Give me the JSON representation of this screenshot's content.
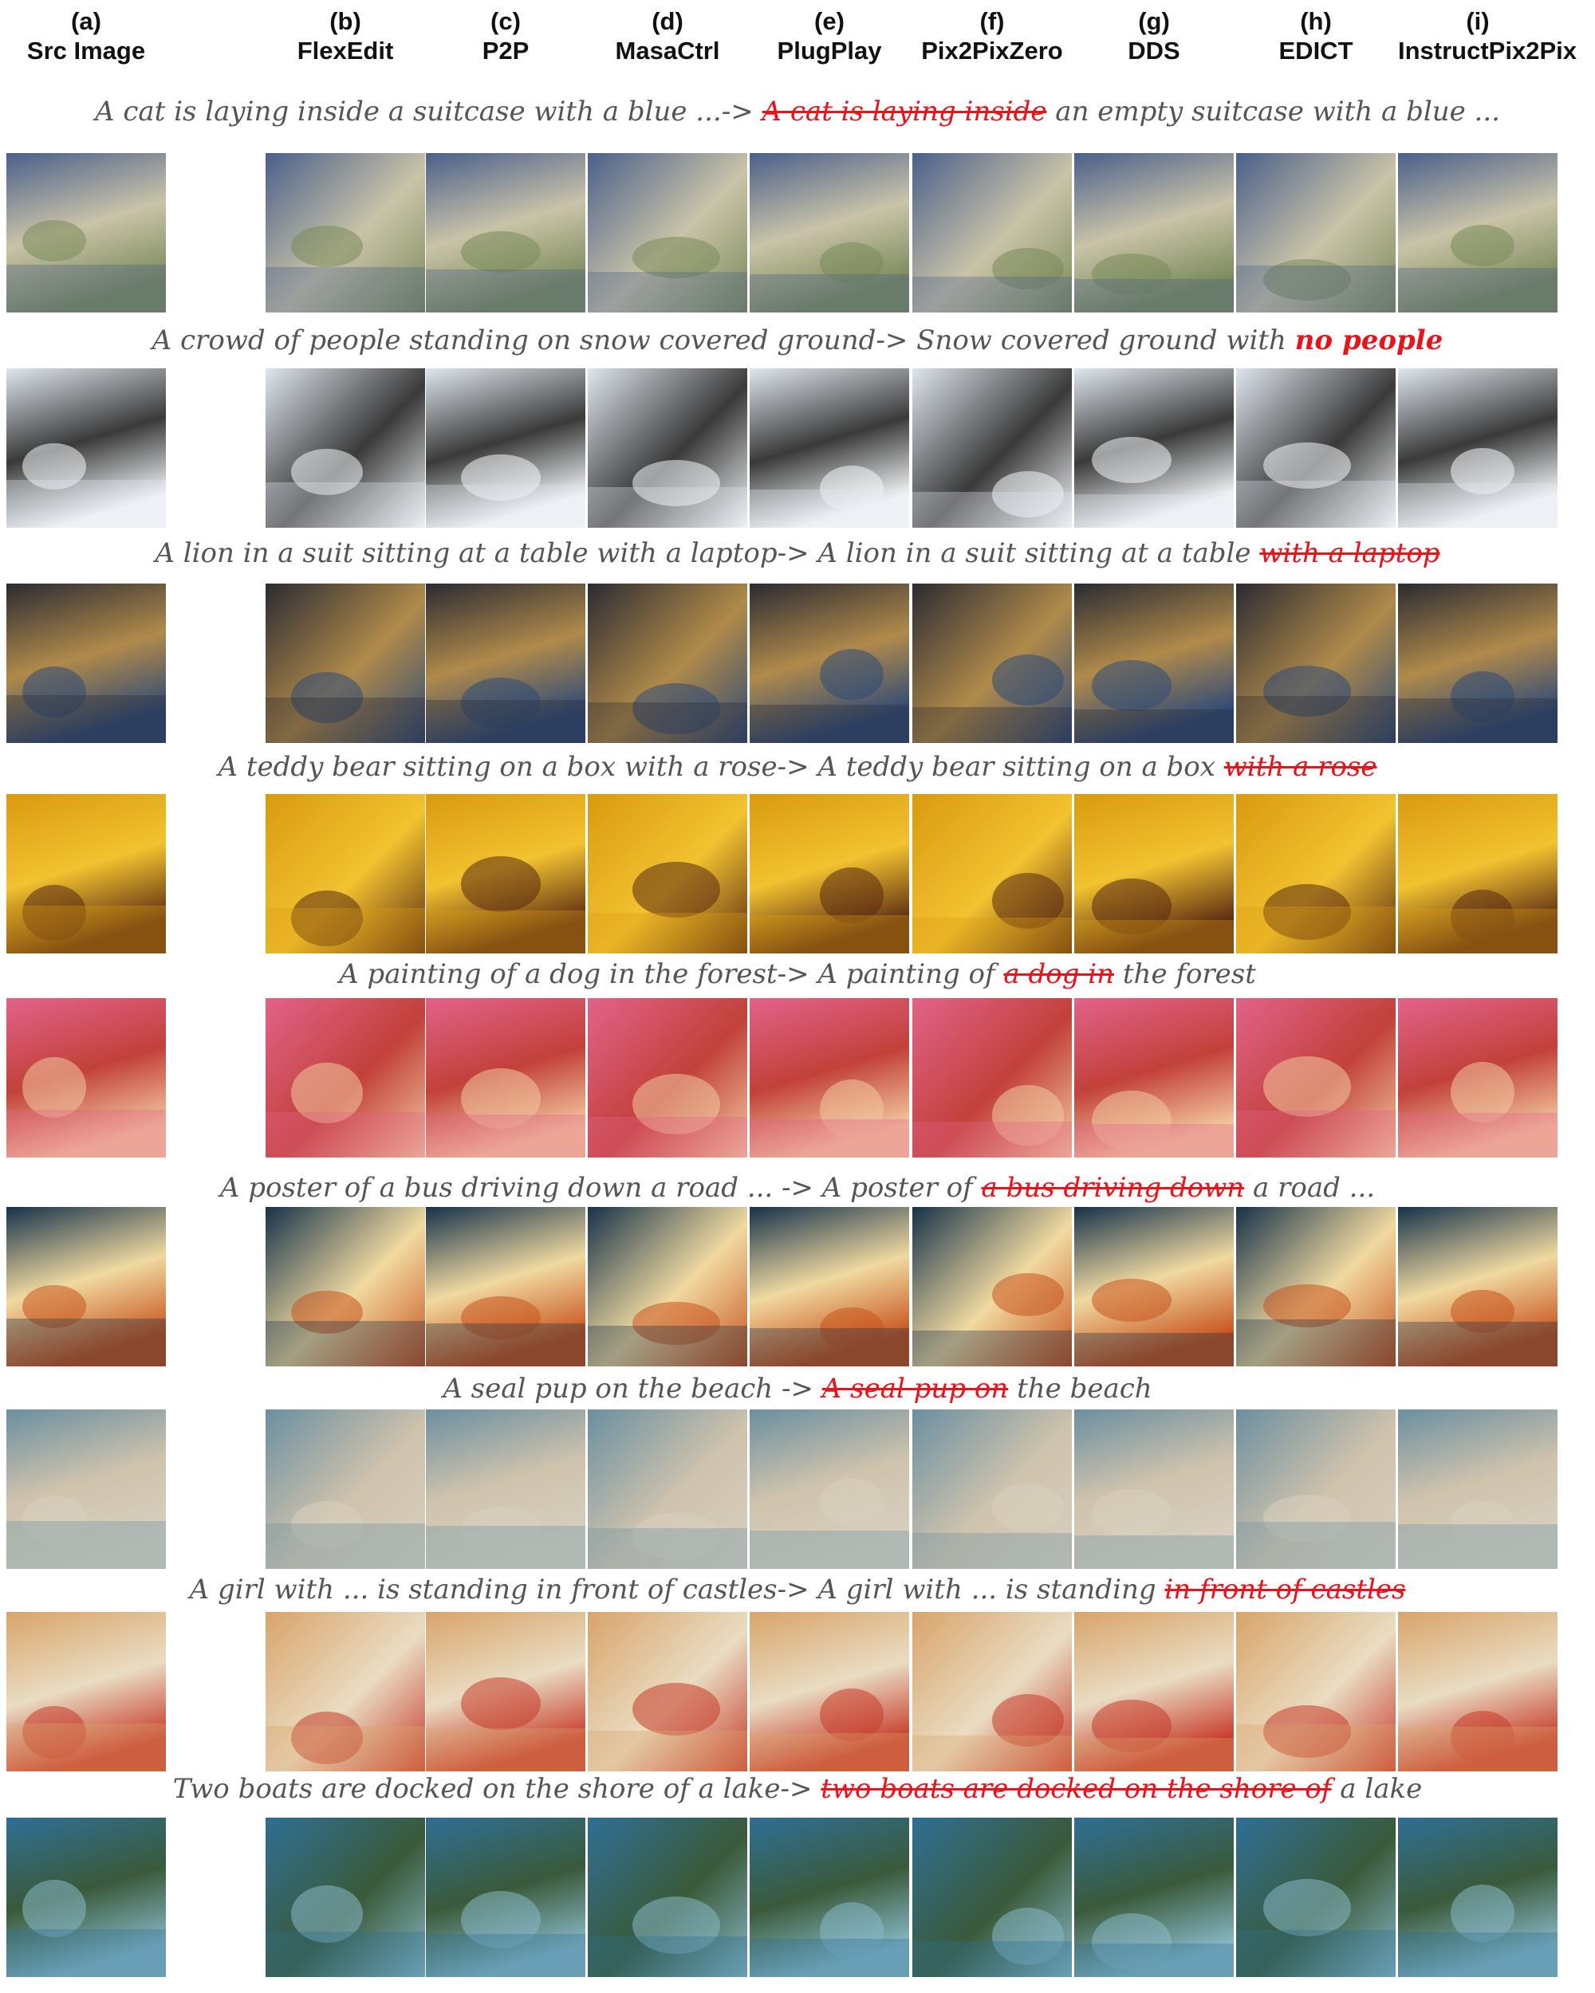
{
  "columns": [
    {
      "label": "(a)",
      "name": "Src Image"
    },
    {
      "label": "(b)",
      "name": "FlexEdit"
    },
    {
      "label": "(c)",
      "name": "P2P"
    },
    {
      "label": "(d)",
      "name": "MasaCtrl"
    },
    {
      "label": "(e)",
      "name": "PlugPlay"
    },
    {
      "label": "(f)",
      "name": "Pix2PixZero"
    },
    {
      "label": "(g)",
      "name": "DDS"
    },
    {
      "label": "(h)",
      "name": "EDICT"
    },
    {
      "label": "(i)",
      "name": "InstructPix2Pix"
    }
  ],
  "rows": [
    {
      "caption": [
        {
          "t": "A cat is laying inside a suitcase with a blue ...-> "
        },
        {
          "t": "A cat is laying inside",
          "s": "strike"
        },
        {
          "t": " an empty suitcase with a blue ..."
        }
      ],
      "palette": [
        "#4a5f8a",
        "#7a8a5a",
        "#c9c3a8"
      ]
    },
    {
      "caption": [
        {
          "t": "A crowd of people standing on snow covered ground-> Snow covered ground with "
        },
        {
          "t": "no people",
          "s": "edit bold"
        }
      ],
      "palette": [
        "#dfe6ee",
        "#f4f6f8",
        "#3a3a3a"
      ]
    },
    {
      "caption": [
        {
          "t": "A lion in a suit sitting at a table with a laptop-> A lion in a suit sitting at a table "
        },
        {
          "t": "with a laptop",
          "s": "strike"
        }
      ],
      "palette": [
        "#2b2b33",
        "#2e4a78",
        "#b08a4a"
      ]
    },
    {
      "caption": [
        {
          "t": "A teddy bear sitting on a box with a rose-> A teddy bear sitting on a box "
        },
        {
          "t": "with a rose",
          "s": "strike"
        }
      ],
      "palette": [
        "#d99a10",
        "#5a2a12",
        "#f2c230"
      ]
    },
    {
      "caption": [
        {
          "t": "A painting of a dog in the forest-> A painting of "
        },
        {
          "t": "a dog in",
          "s": "strike"
        },
        {
          "t": " the forest"
        }
      ],
      "palette": [
        "#e2628a",
        "#f3c9a0",
        "#c2413a"
      ]
    },
    {
      "caption": [
        {
          "t": "A poster of a bus driving down a road ... -> A poster of "
        },
        {
          "t": "a bus driving down",
          "s": "strike"
        },
        {
          "t": " a road ..."
        }
      ],
      "palette": [
        "#16324a",
        "#c8531e",
        "#f0d9a0"
      ]
    },
    {
      "caption": [
        {
          "t": "A seal pup on the beach -> "
        },
        {
          "t": "A seal pup on",
          "s": "strike"
        },
        {
          "t": " the beach"
        }
      ],
      "palette": [
        "#6b8fa0",
        "#d8cfc0",
        "#cfc3ad"
      ]
    },
    {
      "caption": [
        {
          "t": "A girl with ... is standing in front of castles-> A girl with ... is standing "
        },
        {
          "t": "in front of castles",
          "s": "strike"
        }
      ],
      "palette": [
        "#d9a46a",
        "#c73a2a",
        "#e9dcc2"
      ]
    },
    {
      "caption": [
        {
          "t": "Two boats are docked on the shore of a lake-> "
        },
        {
          "t": "two boats are docked on the shore of",
          "s": "strike"
        },
        {
          "t": " a lake"
        }
      ],
      "palette": [
        "#2f6f95",
        "#88b8c8",
        "#3a5a3a"
      ]
    }
  ]
}
